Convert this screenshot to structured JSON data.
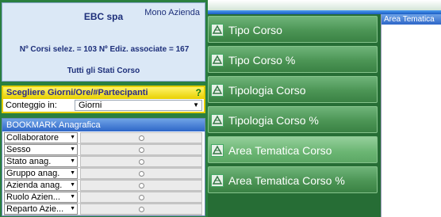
{
  "info": {
    "company": "EBC spa",
    "mode": "Mono Azienda",
    "counts": "Nº Corsi selez. = 103  Nº Ediz. associate = 167",
    "stati": "Tutti gli Stati Corso"
  },
  "giorni_panel": {
    "title": "Scegliere Giorni/Ore/#Partecipanti",
    "help": "?",
    "conteggio_label": "Conteggio in:",
    "conteggio_value": "Giorni"
  },
  "bookmark": {
    "title": "BOOKMARK Anagrafica",
    "rows": [
      {
        "label": "Collaboratore"
      },
      {
        "label": "Sesso"
      },
      {
        "label": "Stato anag."
      },
      {
        "label": "Gruppo anag."
      },
      {
        "label": "Azienda anag."
      },
      {
        "label": "Ruolo Azien..."
      },
      {
        "label": "Reparto Azie..."
      }
    ]
  },
  "menu": {
    "items": [
      {
        "label": "Tipo Corso",
        "icon": "ruler-icon"
      },
      {
        "label": "Tipo Corso %",
        "icon": "ruler-icon"
      },
      {
        "label": "Tipologia Corso",
        "icon": "ruler-icon"
      },
      {
        "label": "Tipologia Corso %",
        "icon": "ruler-icon"
      },
      {
        "label": "Area Tematica Corso",
        "icon": "ruler-icon"
      },
      {
        "label": "Area Tematica Corso %",
        "icon": "ruler-icon"
      }
    ]
  },
  "area_tematica_panel": {
    "title": "Area Tematica"
  },
  "colors": {
    "background_green": "#266d35",
    "info_bg": "#dbe8f6",
    "info_text": "#1d2f7a",
    "yellow_header": "#e8d000",
    "blue_header": "#2e66c8"
  }
}
